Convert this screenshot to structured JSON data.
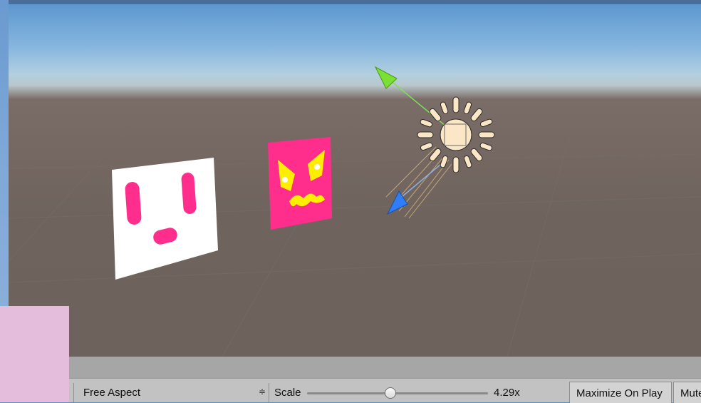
{
  "scene": {
    "objects": [
      "white-face-card",
      "pink-angry-face-card",
      "directional-light-sun-icon"
    ],
    "gizmo": [
      "green-arrow-icon",
      "blue-arrow-icon"
    ]
  },
  "toolbar": {
    "aspect_label": "Free Aspect",
    "aspect_arrow": "≑",
    "scale_label": "Scale",
    "scale_value": "4.29x",
    "scale_fraction": 0.46,
    "maximize_label": "Maximize On Play",
    "mute_label": "Mute Audio"
  },
  "colors": {
    "sky_top": "#5d97cf",
    "ground": "#6f635d",
    "face_pink": "#ff2e8c",
    "face_yellow": "#ffee00",
    "toolbar_bg": "#c2c2c2",
    "side_panel": "#e3bddb"
  }
}
